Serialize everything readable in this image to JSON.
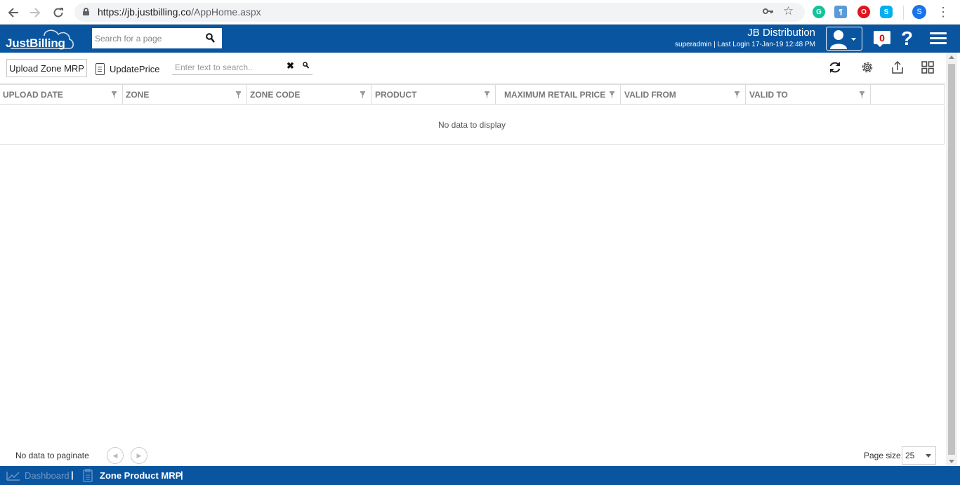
{
  "browser": {
    "url_host": "https://jb.justbilling.co",
    "url_path": "/AppHome.aspx",
    "profile_initial": "S",
    "extensions": [
      {
        "name": "grammarly-icon",
        "letter": "G",
        "color": "#15c39a"
      },
      {
        "name": "extension-icon",
        "letter": "¶",
        "color": "#5b9bd5"
      },
      {
        "name": "opera-icon",
        "letter": "O",
        "color": "#e0151e"
      },
      {
        "name": "skype-icon",
        "letter": "S",
        "color": "#00aff0"
      }
    ]
  },
  "app": {
    "logo_text": "JustBilling",
    "page_search_placeholder": "Search for a page",
    "company_name": "JB Distribution",
    "login_info": "superadmin | Last Login 17-Jan-19 12:48 PM",
    "notification_count": "0",
    "help_symbol": "?",
    "brand_color": "#0a55a0"
  },
  "toolbar": {
    "upload_label": "Upload Zone MRP",
    "update_price_label": "UpdatePrice",
    "grid_search_placeholder": "Enter text to search..",
    "clear_symbol": "✖"
  },
  "grid": {
    "columns": [
      "UPLOAD DATE",
      "ZONE",
      "ZONE CODE",
      "PRODUCT",
      "MAXIMUM RETAIL PRICE",
      "VALID FROM",
      "VALID TO"
    ],
    "empty_text": "No data to display"
  },
  "pager": {
    "text": "No data to paginate",
    "page_size_label": "Page size:",
    "page_size": "25"
  },
  "footer": {
    "dashboard_label": "Dashboard",
    "current_label": "Zone Product MRP",
    "separator": "|"
  }
}
